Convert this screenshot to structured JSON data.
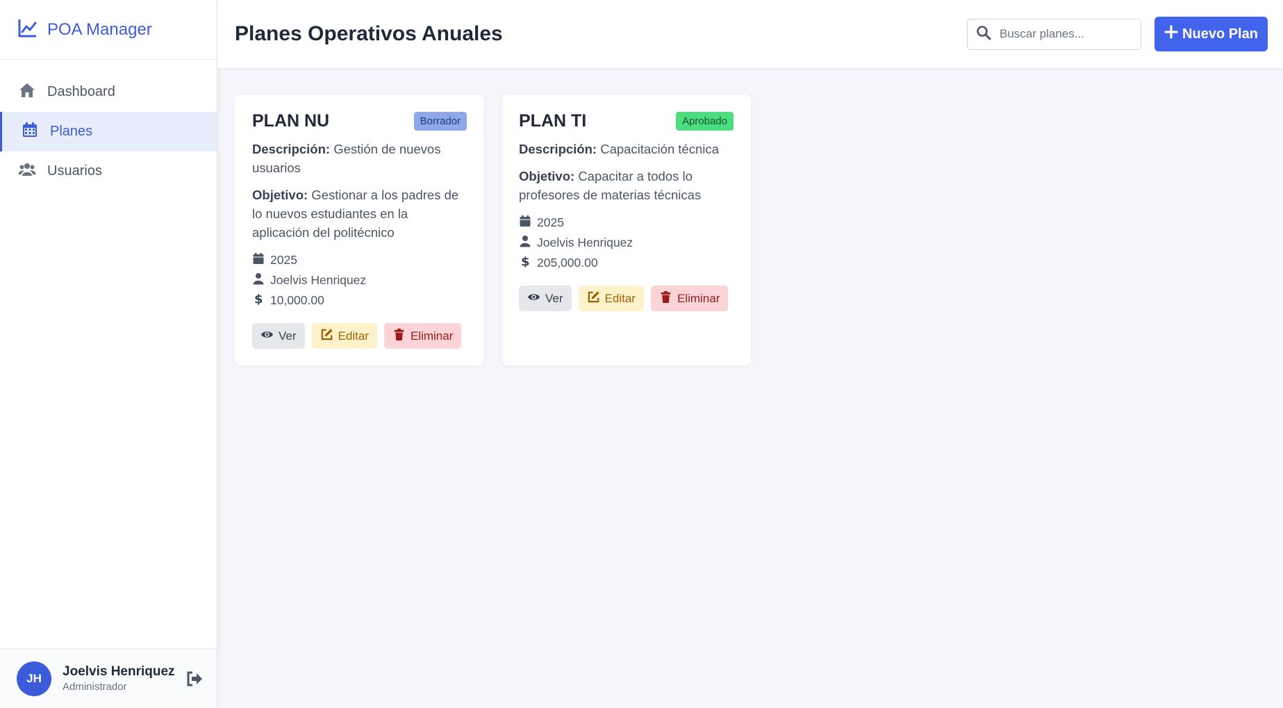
{
  "app": {
    "name": "POA Manager"
  },
  "sidebar": {
    "items": [
      {
        "label": "Dashboard",
        "icon": "home-icon"
      },
      {
        "label": "Planes",
        "icon": "calendar-icon",
        "active": true
      },
      {
        "label": "Usuarios",
        "icon": "users-icon"
      }
    ]
  },
  "user": {
    "initials": "JH",
    "name": "Joelvis Henriquez",
    "role": "Administrador"
  },
  "header": {
    "title": "Planes Operativos Anuales",
    "search_placeholder": "Buscar planes...",
    "new_button": "Nuevo Plan"
  },
  "labels": {
    "description": "Descripción:",
    "objective": "Objetivo:"
  },
  "plans": [
    {
      "title": "PLAN NU",
      "status": "Borrador",
      "status_color": "#8fa8e8",
      "description": "Gestión de nuevos usuarios",
      "objective": "Gestionar a los padres de lo nuevos estudiantes en la aplicación del politécnico",
      "year": "2025",
      "owner": "Joelvis Henriquez",
      "amount": "10,000.00",
      "actions": {
        "view": "Ver",
        "edit": "Editar",
        "delete": "Eliminar"
      }
    },
    {
      "title": "PLAN TI",
      "status": "Aprobado",
      "status_color": "#4ade80",
      "description": "Capacitación técnica",
      "objective": "Capacitar a todos lo profesores de materias técnicas",
      "year": "2025",
      "owner": "Joelvis Henriquez",
      "amount": "205,000.00",
      "actions": {
        "view": "Ver",
        "edit": "Editar",
        "delete": "Eliminar"
      }
    }
  ],
  "colors": {
    "accent": "#3b5bdb",
    "primary_button": "#4263eb"
  }
}
